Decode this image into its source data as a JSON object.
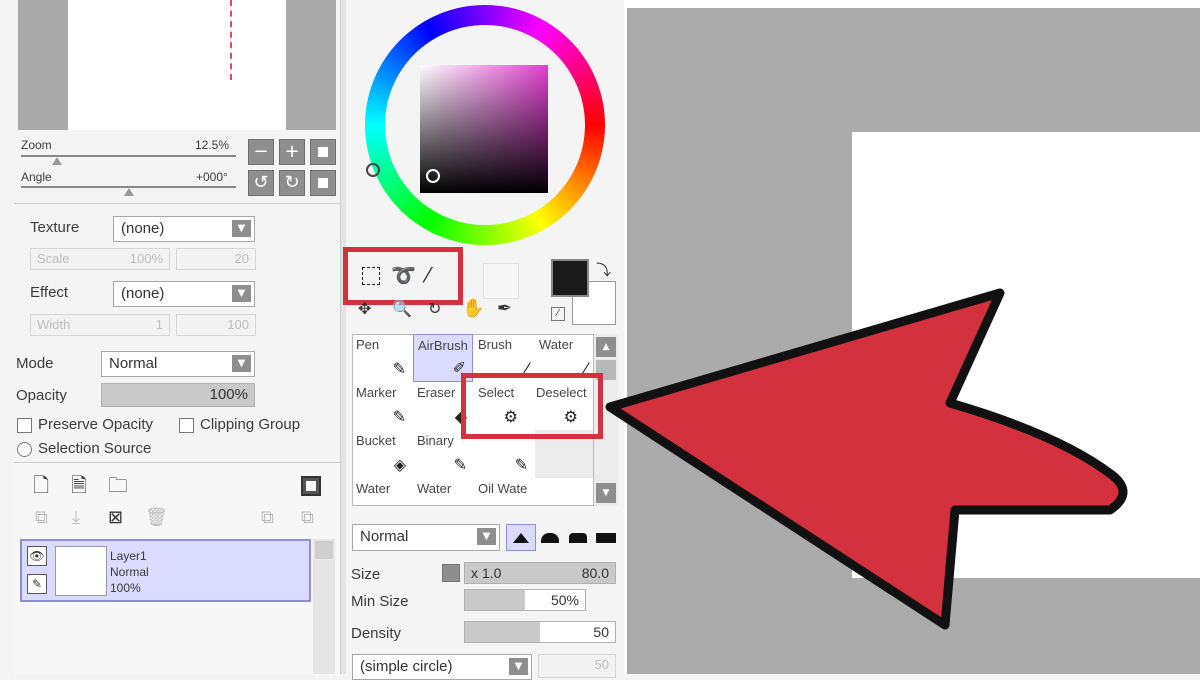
{
  "navigator": {
    "zoom_label": "Zoom",
    "zoom_value": "12.5%",
    "angle_label": "Angle",
    "angle_value": "+000°"
  },
  "texture": {
    "label": "Texture",
    "value": "(none)",
    "scale_label": "Scale",
    "scale_value": "100%",
    "scale_num": "20"
  },
  "effect": {
    "label": "Effect",
    "value": "(none)",
    "width_label": "Width",
    "width_value": "1",
    "width_num": "100"
  },
  "layer_props": {
    "mode_label": "Mode",
    "mode_value": "Normal",
    "opacity_label": "Opacity",
    "opacity_value": "100%",
    "preserve_opacity": "Preserve Opacity",
    "clipping_group": "Clipping Group",
    "selection_source": "Selection Source"
  },
  "layers": [
    {
      "name": "Layer1",
      "mode": "Normal",
      "opacity": "100%"
    }
  ],
  "tools": [
    {
      "name": "Pen",
      "icon": "pen-icon"
    },
    {
      "name": "AirBrush",
      "icon": "airbrush-icon"
    },
    {
      "name": "Brush",
      "icon": "brush-icon"
    },
    {
      "name": "Water",
      "icon": "water-brush-icon"
    },
    {
      "name": "Marker",
      "icon": "marker-icon"
    },
    {
      "name": "Eraser",
      "icon": "eraser-icon"
    },
    {
      "name": "Select",
      "icon": "select-brush-icon"
    },
    {
      "name": "Deselect",
      "icon": "deselect-brush-icon"
    },
    {
      "name": "Bucket",
      "icon": "bucket-icon"
    },
    {
      "name": "Binary",
      "icon": "binary-pen-icon"
    },
    {
      "name": "Water",
      "icon": "water-icon"
    },
    {
      "name": "Water",
      "icon": "water-icon"
    },
    {
      "name": "Oil Wate",
      "icon": "oil-water-icon"
    }
  ],
  "brush": {
    "blend_mode": "Normal",
    "size_label": "Size",
    "size_multiplier": "x 1.0",
    "size_value": "80.0",
    "min_size_label": "Min Size",
    "min_size_value": "50%",
    "density_label": "Density",
    "density_value": "50",
    "shape_value": "(simple circle)",
    "shape_num": "50"
  },
  "colors": {
    "highlight_red": "#d4313f",
    "foreground": "#1a1a1a",
    "background": "#ffffff",
    "selection_blue": "#dadbff"
  }
}
